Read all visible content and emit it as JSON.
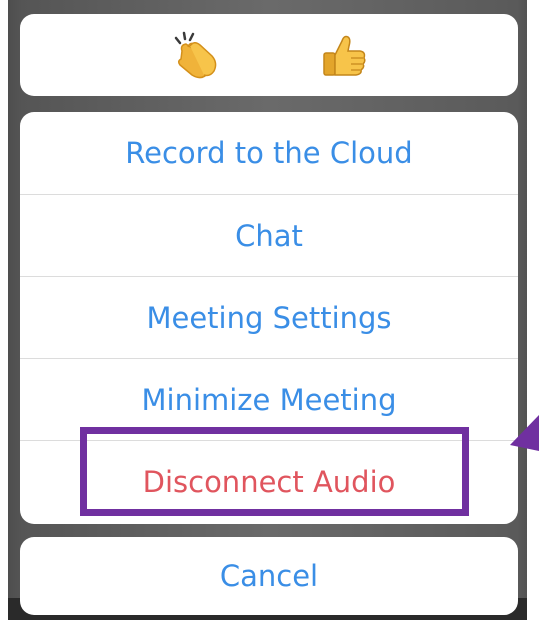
{
  "reactions": [
    {
      "name": "clap",
      "icon": "clapping-hands-icon"
    },
    {
      "name": "thumbs-up",
      "icon": "thumbs-up-icon"
    }
  ],
  "menu": {
    "items": [
      {
        "label": "Record to the Cloud"
      },
      {
        "label": "Chat"
      },
      {
        "label": "Meeting Settings"
      },
      {
        "label": "Minimize Meeting"
      },
      {
        "label": "Disconnect Audio"
      }
    ]
  },
  "cancel": {
    "label": "Cancel"
  },
  "colors": {
    "action_blue": "#3a8ee6",
    "destructive_red": "#e0555e",
    "highlight_purple": "#7030a0"
  }
}
